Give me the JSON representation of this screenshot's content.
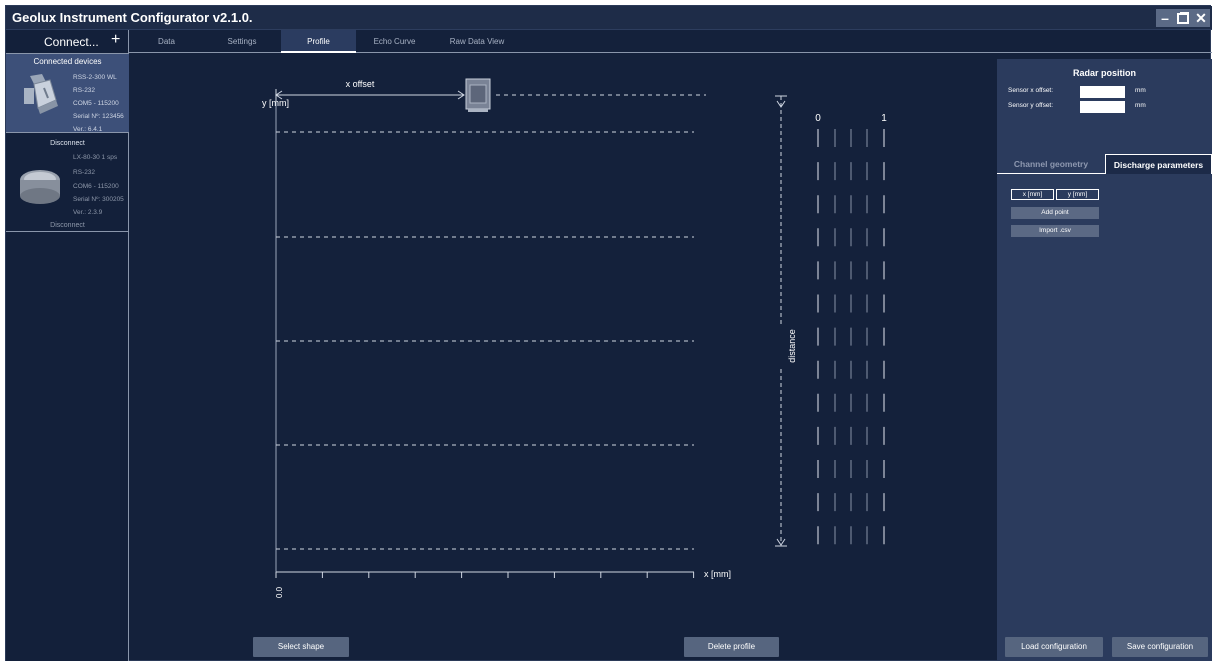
{
  "window": {
    "title": "Geolux Instrument Configurator v2.1.0."
  },
  "sidebar": {
    "connect_label": "Connect...",
    "connected_title": "Connected devices",
    "devices": [
      {
        "name": "RSS-2-300 WL",
        "interface": "RS-232",
        "port": "COM5 - 115200",
        "serial": "Serial Nº: 123456",
        "version": "Ver.: 6.4.1",
        "disconnect": "Disconnect"
      },
      {
        "name": "LX-80-30 1 sps",
        "interface": "RS-232",
        "port": "COM6 - 115200",
        "serial": "Serial Nº: 300205",
        "version": "Ver.: 2.3.9",
        "disconnect": "Disconnect"
      }
    ]
  },
  "tabs": [
    "Data",
    "Settings",
    "Profile",
    "Echo Curve",
    "Raw Data View"
  ],
  "plot": {
    "y_axis_label": "y [mm]",
    "x_axis_label": "x [mm]",
    "x_offset_label": "x offset",
    "x_tick_zero": "0.0",
    "distance_label": "distance",
    "scale_labels": [
      "0",
      "1"
    ]
  },
  "buttons": {
    "select_shape": "Select shape",
    "delete_profile": "Delete profile"
  },
  "right_panel": {
    "title": "Radar position",
    "sensor_x_label": "Sensor x offset:",
    "sensor_y_label": "Sensor y offset:",
    "sensor_x_value": "",
    "sensor_y_value": "",
    "unit": "mm",
    "tab_channel": "Channel geometry",
    "tab_discharge": "Discharge parameters",
    "col_x": "x [mm]",
    "col_y": "y [mm]",
    "add_point": "Add point",
    "import_csv": "Import .csv",
    "load_config": "Load configuration",
    "save_config": "Save configuration"
  },
  "colors": {
    "background": "#14213b",
    "panel": "#2b3b5d",
    "button": "#56657f"
  }
}
